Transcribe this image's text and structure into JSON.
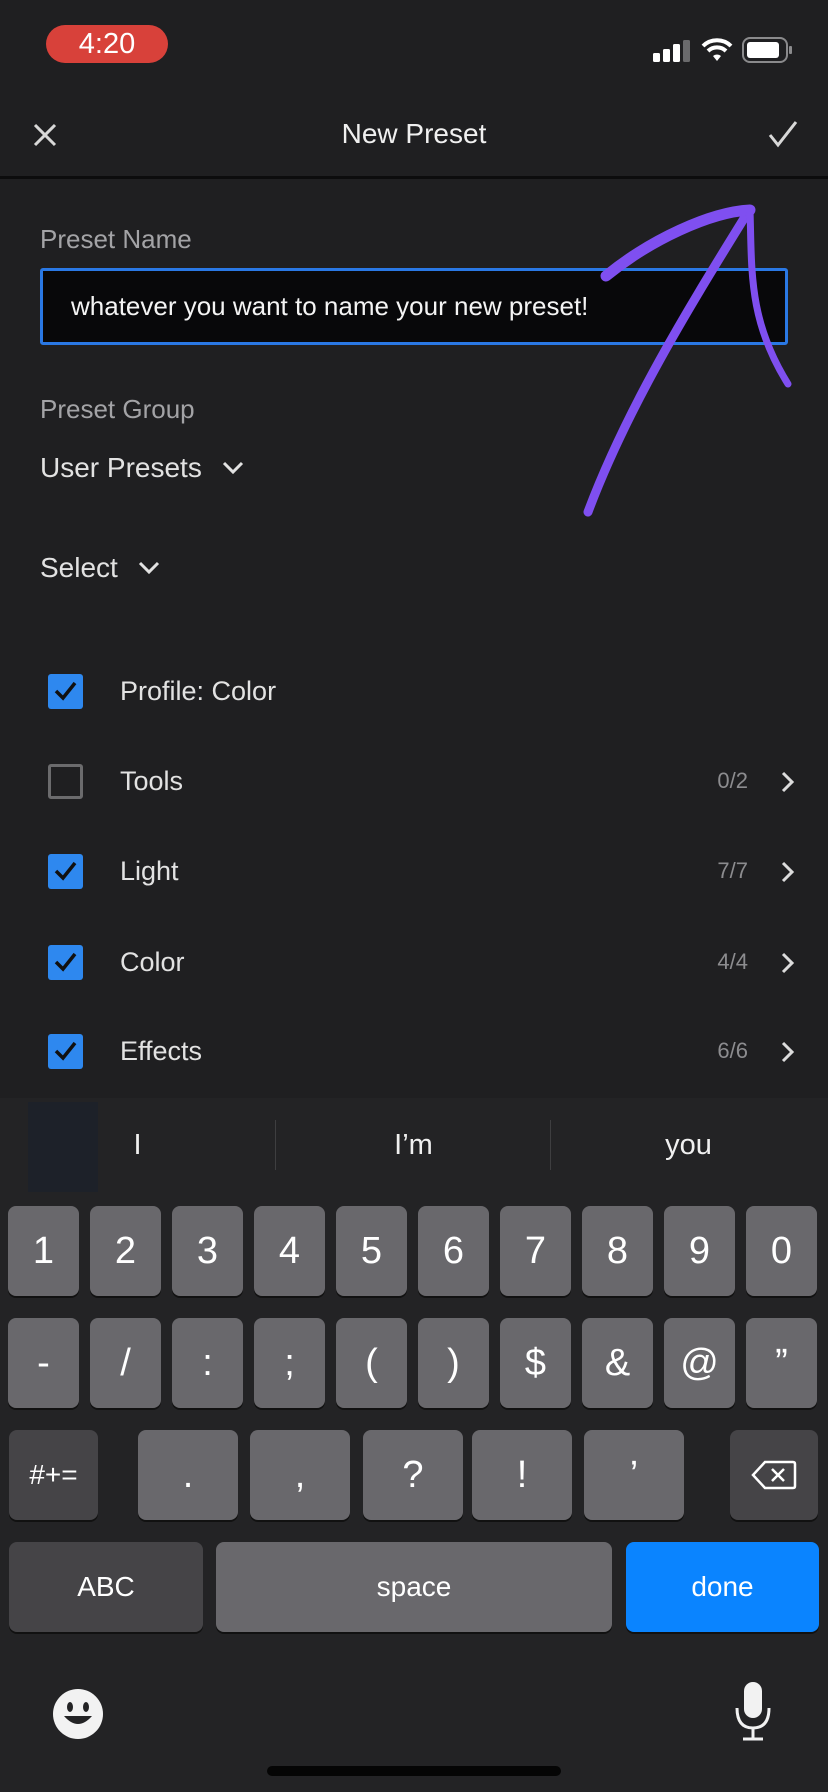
{
  "status_bar": {
    "time": "4:20",
    "signal": "signal-icon",
    "wifi": "wifi-icon",
    "battery": "battery-icon"
  },
  "header": {
    "title": "New Preset",
    "close_icon": "close-icon",
    "confirm_icon": "checkmark-icon"
  },
  "form": {
    "preset_name_label": "Preset Name",
    "preset_name_value": "whatever you want to name your new preset!",
    "preset_group_label": "Preset Group",
    "preset_group_value": "User Presets",
    "select_label": "Select"
  },
  "settings": [
    {
      "label": "Profile: Color",
      "checked": true,
      "count": ""
    },
    {
      "label": "Tools",
      "checked": false,
      "count": "0/2"
    },
    {
      "label": "Light",
      "checked": true,
      "count": "7/7"
    },
    {
      "label": "Color",
      "checked": true,
      "count": "4/4"
    },
    {
      "label": "Effects",
      "checked": true,
      "count": "6/6"
    }
  ],
  "annotation": {
    "color": "#7f4ff0",
    "type": "hand-drawn-arrow"
  },
  "keyboard": {
    "suggestions": [
      "I",
      "I’m",
      "you"
    ],
    "row1": [
      "1",
      "2",
      "3",
      "4",
      "5",
      "6",
      "7",
      "8",
      "9",
      "0"
    ],
    "row2": [
      "-",
      "/",
      ":",
      ";",
      "(",
      ")",
      "$",
      "&",
      "@",
      "”"
    ],
    "row3": [
      "#+=",
      ".",
      ",",
      "?",
      "!",
      "’"
    ],
    "abc": "ABC",
    "space": "space",
    "done": "done",
    "done_color": "#0a84ff"
  }
}
